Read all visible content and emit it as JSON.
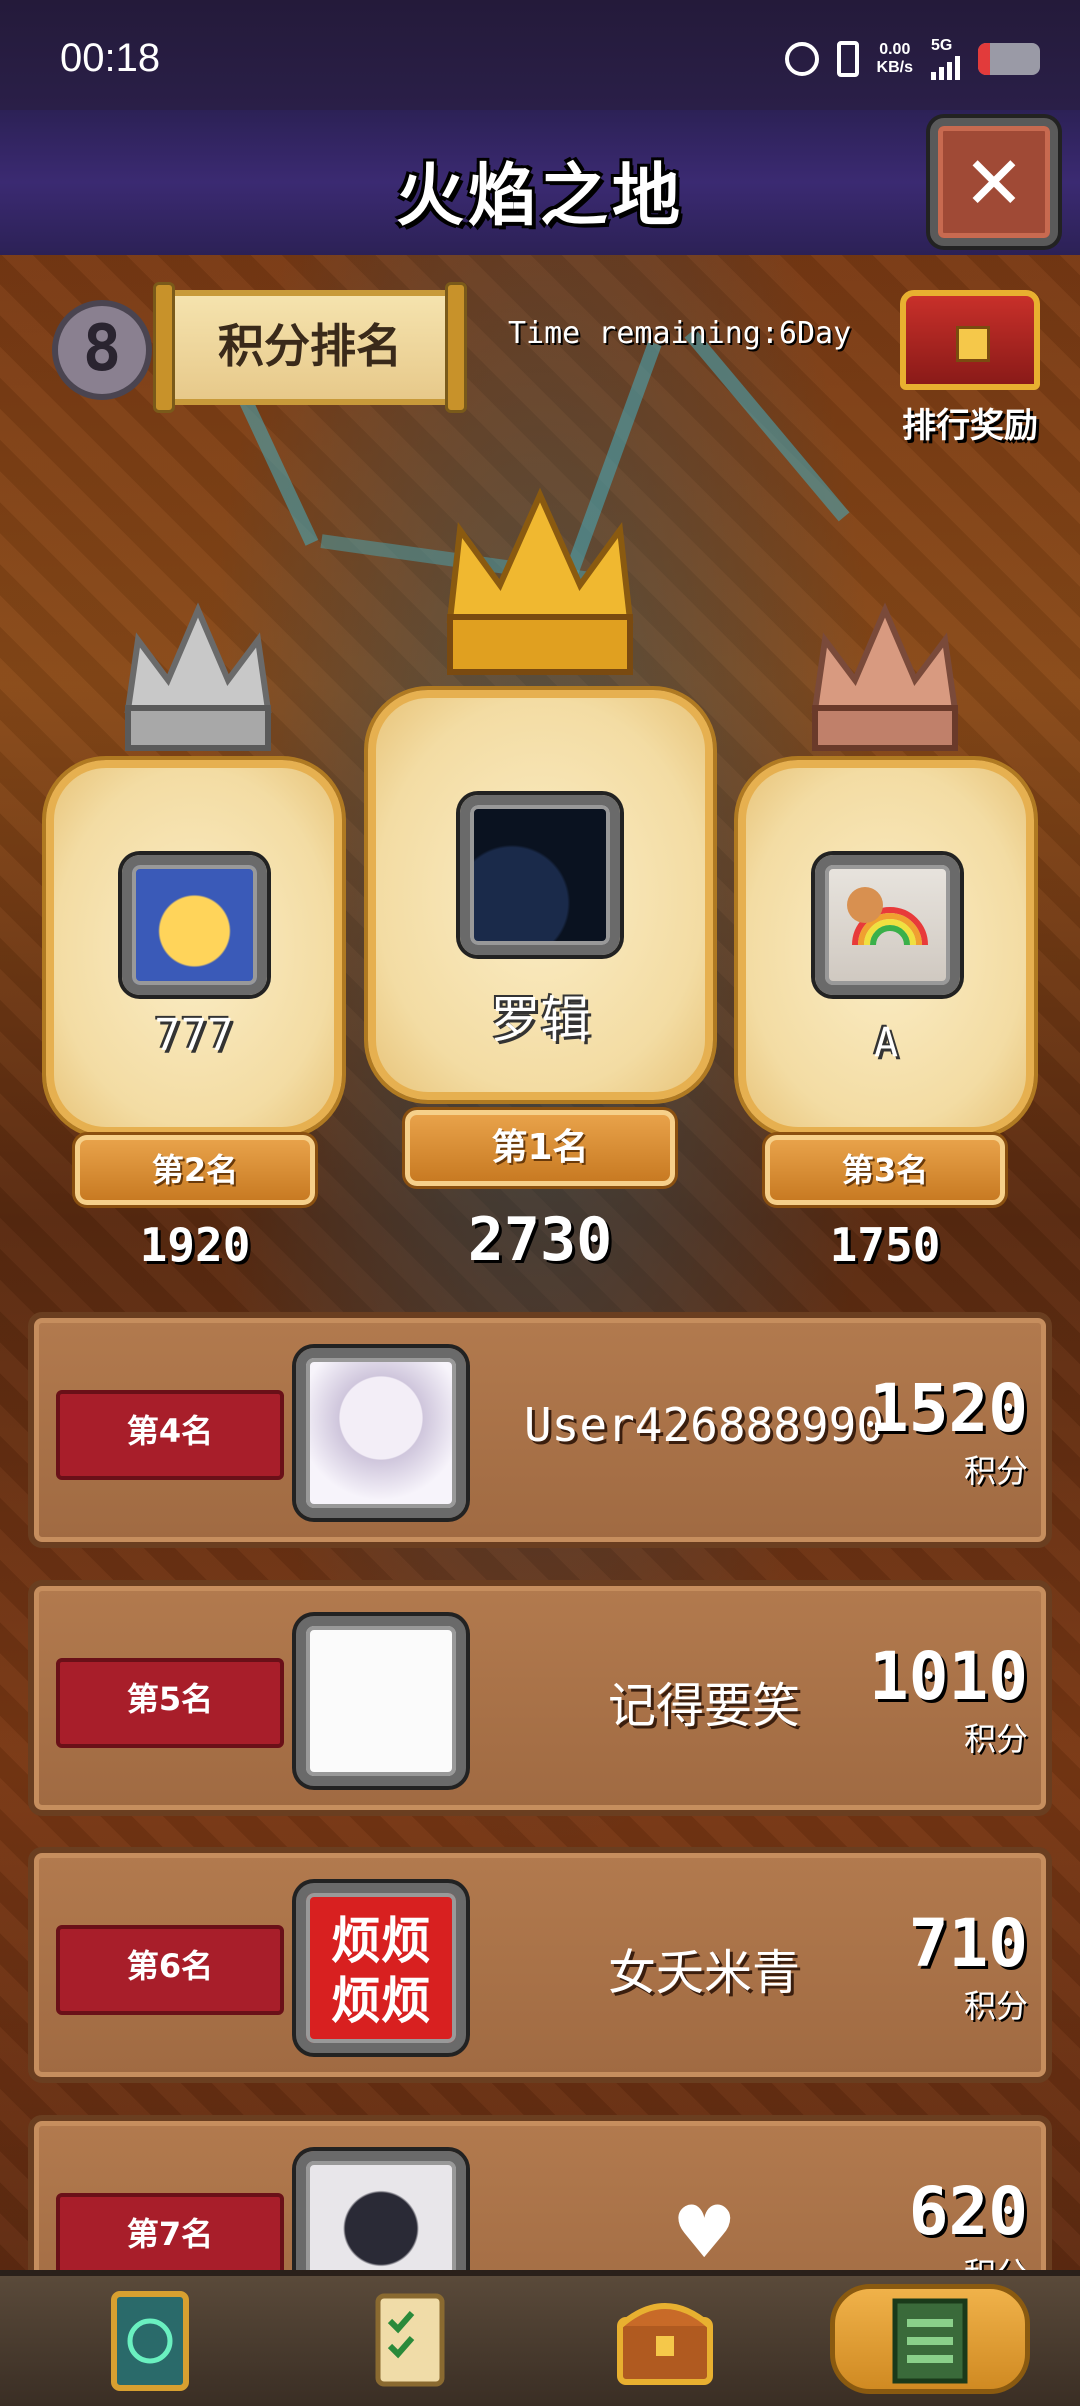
{
  "status_bar": {
    "time": "00:18",
    "net_speed_value": "0.00",
    "net_speed_unit": "KB/s",
    "signal_label": "5G",
    "battery_level": 0.2
  },
  "header": {
    "title": "火焰之地"
  },
  "leaderboard": {
    "season_badge": "8",
    "title": "积分排名",
    "time_remaining": "Time remaining:6Day",
    "reward_label": "排行奖励"
  },
  "podium": {
    "first": {
      "name": "罗辑",
      "rank_label": "第1名",
      "score": "2730"
    },
    "second": {
      "name": "777",
      "rank_label": "第2名",
      "score": "1920"
    },
    "third": {
      "name": "A",
      "rank_label": "第3名",
      "score": "1750"
    }
  },
  "rows": [
    {
      "rank_label": "第4名",
      "name": "User426888990",
      "score": "1520",
      "unit": "积分"
    },
    {
      "rank_label": "第5名",
      "name": "记得要笑",
      "score": "1010",
      "unit": "积分"
    },
    {
      "rank_label": "第6名",
      "name": "女夭米青",
      "score": "710",
      "unit": "积分",
      "avatar_text": [
        "烦烦",
        "烦烦"
      ]
    },
    {
      "rank_label": "第7名",
      "name": "",
      "score": "620",
      "unit": "积分"
    }
  ],
  "colors": {
    "header_bg": "#3b2a72",
    "parchment": "#f3dca3",
    "rank_ribbon": "#a81e2a",
    "row_bg": "#a06a42",
    "gold": "#e8b030"
  },
  "icons": {
    "close": "close-icon",
    "reward": "treasure-chest-icon",
    "nav": [
      "spell-card-icon",
      "quest-scroll-icon",
      "treasure-chest-icon",
      "leaderboard-icon"
    ]
  }
}
